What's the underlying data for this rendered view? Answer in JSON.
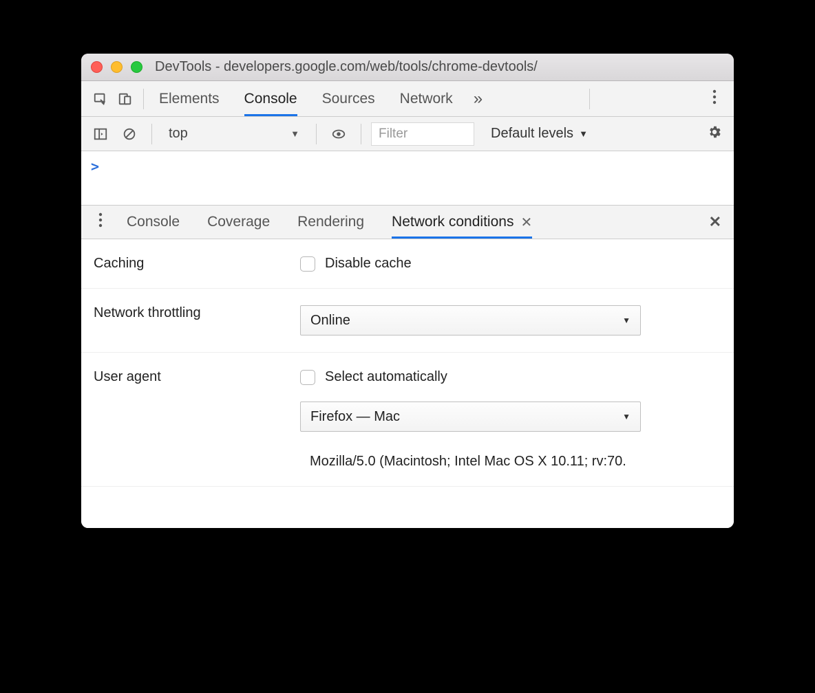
{
  "window": {
    "title": "DevTools - developers.google.com/web/tools/chrome-devtools/"
  },
  "main_tabs": {
    "items": [
      "Elements",
      "Console",
      "Sources",
      "Network"
    ],
    "active": "Console",
    "overflow_glyph": "»"
  },
  "console_toolbar": {
    "context": "top",
    "filter_placeholder": "Filter",
    "levels_label": "Default levels"
  },
  "console": {
    "prompt": ">"
  },
  "drawer": {
    "tabs": [
      "Console",
      "Coverage",
      "Rendering",
      "Network conditions"
    ],
    "active": "Network conditions"
  },
  "network_conditions": {
    "caching": {
      "label": "Caching",
      "checkbox_label": "Disable cache"
    },
    "throttling": {
      "label": "Network throttling",
      "value": "Online"
    },
    "user_agent": {
      "label": "User agent",
      "checkbox_label": "Select automatically",
      "value": "Firefox — Mac",
      "ua_string": "Mozilla/5.0 (Macintosh; Intel Mac OS X 10.11; rv:70."
    }
  }
}
